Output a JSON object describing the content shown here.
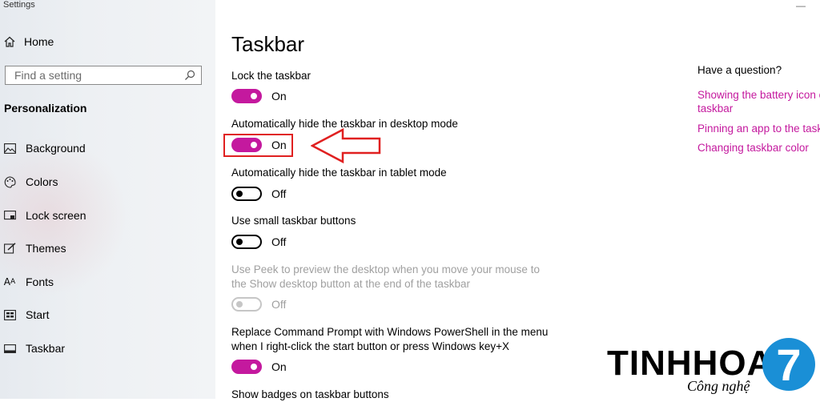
{
  "window": {
    "title": "Settings",
    "minimize_glyph": "—"
  },
  "sidebar": {
    "home_label": "Home",
    "search_placeholder": "Find a setting",
    "section": "Personalization",
    "items": [
      {
        "label": "Background",
        "icon": "picture-icon"
      },
      {
        "label": "Colors",
        "icon": "palette-icon"
      },
      {
        "label": "Lock screen",
        "icon": "lock-screen-icon"
      },
      {
        "label": "Themes",
        "icon": "brush-icon"
      },
      {
        "label": "Fonts",
        "icon": "font-icon"
      },
      {
        "label": "Start",
        "icon": "start-icon"
      },
      {
        "label": "Taskbar",
        "icon": "taskbar-icon"
      }
    ]
  },
  "main": {
    "title": "Taskbar",
    "settings": [
      {
        "label": "Lock the taskbar",
        "state": "On"
      },
      {
        "label": "Automatically hide the taskbar in desktop mode",
        "state": "On"
      },
      {
        "label": "Automatically hide the taskbar in tablet mode",
        "state": "Off"
      },
      {
        "label": "Use small taskbar buttons",
        "state": "Off"
      },
      {
        "label_line1": "Use Peek to preview the desktop when you move your mouse to",
        "label_line2": "the Show desktop button at the end of the taskbar",
        "state": "Off",
        "disabled": true
      },
      {
        "label_line1": "Replace Command Prompt with Windows PowerShell in the menu",
        "label_line2": "when I right-click the start button or press Windows key+X",
        "state": "On"
      },
      {
        "label": "Show badges on taskbar buttons"
      }
    ]
  },
  "help": {
    "title": "Have a question?",
    "links": [
      {
        "line1": "Showing the battery icon o",
        "line2": "taskbar"
      },
      {
        "line1": "Pinning an app to the taskb"
      },
      {
        "line1": "Changing taskbar color"
      }
    ]
  },
  "watermark": {
    "brand": "TINHHOA",
    "tagline": "Công nghệ",
    "digit": "7"
  },
  "colors": {
    "accent": "#c4199e",
    "highlight": "#e02020",
    "logo_blue": "#1a8fd6"
  }
}
